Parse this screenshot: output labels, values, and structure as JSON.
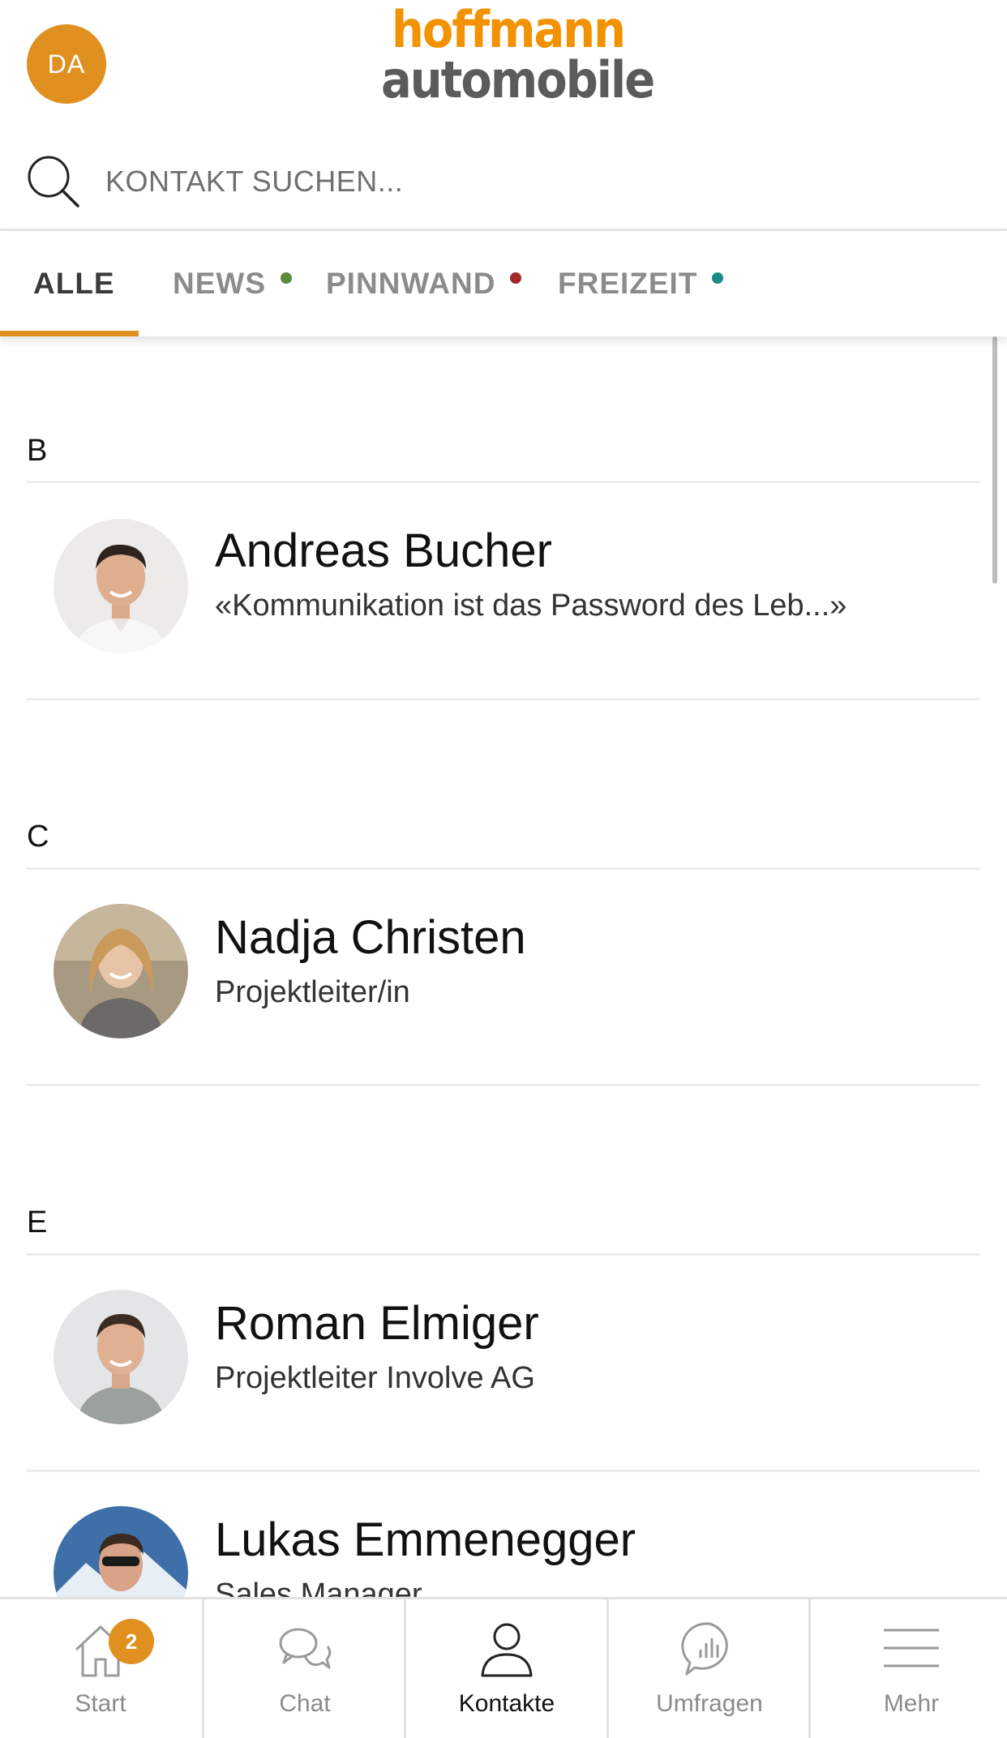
{
  "header": {
    "user_initials": "DA",
    "logo_line1": "hoffmann",
    "logo_line2": "automobile"
  },
  "search": {
    "placeholder": "KONTAKT SUCHEN..."
  },
  "tabs": [
    {
      "label": "ALLE",
      "active": true
    },
    {
      "label": "NEWS",
      "dot_color": "#5c8a3c"
    },
    {
      "label": "PINNWAND",
      "dot_color": "#a32a2a"
    },
    {
      "label": "FREIZEIT",
      "dot_color": "#1b8a8a"
    }
  ],
  "contacts": {
    "sections": [
      {
        "letter": "B",
        "people": [
          {
            "name": "Andreas Bucher",
            "subtitle": "«Kommunikation ist das Password des Leb...»"
          }
        ]
      },
      {
        "letter": "C",
        "people": [
          {
            "name": "Nadja Christen",
            "subtitle": "Projektleiter/in"
          }
        ]
      },
      {
        "letter": "E",
        "people": [
          {
            "name": "Roman Elmiger",
            "subtitle": "Projektleiter Involve AG"
          },
          {
            "name": "Lukas Emmenegger",
            "subtitle": "Sales Manager"
          }
        ]
      }
    ]
  },
  "bottom_nav": {
    "items": [
      {
        "label": "Start",
        "icon": "home-icon",
        "badge": "2"
      },
      {
        "label": "Chat",
        "icon": "chat-icon"
      },
      {
        "label": "Kontakte",
        "icon": "person-icon",
        "active": true
      },
      {
        "label": "Umfragen",
        "icon": "poll-icon"
      },
      {
        "label": "Mehr",
        "icon": "menu-icon"
      }
    ]
  },
  "colors": {
    "accent": "#e0901f",
    "logo_orange": "#f39200",
    "logo_grey": "#5b5b5b"
  }
}
